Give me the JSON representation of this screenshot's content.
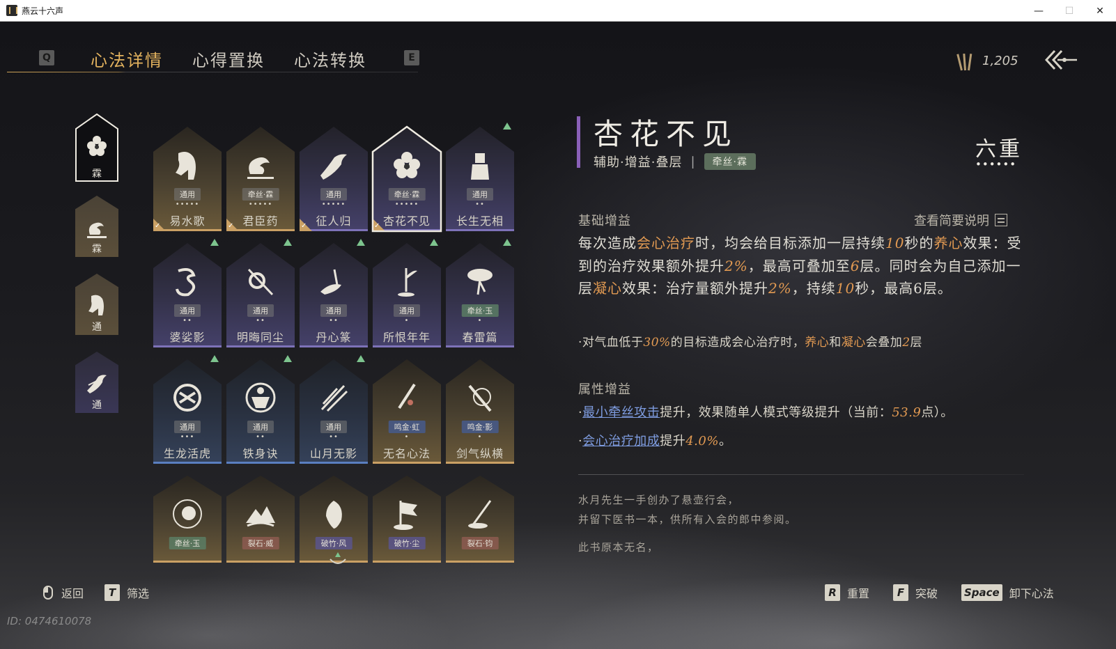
{
  "window": {
    "title": "燕云十六声",
    "min": "—",
    "max": "☐",
    "close": "✕"
  },
  "tabs": {
    "key_left": "Q",
    "key_right": "E",
    "items": [
      "心法详情",
      "心得置换",
      "心法转换"
    ],
    "active": 0
  },
  "currency": {
    "value": "1,205"
  },
  "categories": [
    {
      "label": "霖",
      "icon": "flower-icon",
      "selected": true
    },
    {
      "label": "霖",
      "icon": "cauldron-icon",
      "selected": false
    },
    {
      "label": "通",
      "icon": "horse-icon",
      "selected": false
    },
    {
      "label": "通",
      "icon": "bird-icon",
      "selected": false
    }
  ],
  "cards": [
    {
      "name": "易水歌",
      "tag": "通用",
      "tag_color": "gray",
      "dots": "•••••",
      "bg": "gold",
      "checked": true,
      "up": false,
      "icon": "horse-icon"
    },
    {
      "name": "君臣药",
      "tag": "牵丝·霖",
      "tag_color": "gray",
      "dots": "•••••",
      "bg": "gold",
      "checked": true,
      "up": false,
      "icon": "cauldron-icon"
    },
    {
      "name": "征人归",
      "tag": "通用",
      "tag_color": "gray",
      "dots": "•••••",
      "bg": "purple",
      "checked": true,
      "up": false,
      "icon": "bird-icon"
    },
    {
      "name": "杏花不见",
      "tag": "牵丝·霖",
      "tag_color": "gray",
      "dots": "•••••",
      "bg": "purple",
      "checked": true,
      "up": false,
      "selected": true,
      "icon": "flower-icon"
    },
    {
      "name": "长生无相",
      "tag": "通用",
      "tag_color": "gray",
      "dots": "••",
      "bg": "purple",
      "checked": false,
      "up": true,
      "icon": "statue-icon"
    },
    {
      "name": "婆娑影",
      "tag": "通用",
      "tag_color": "gray",
      "dots": "••",
      "bg": "purple",
      "checked": false,
      "up": true,
      "icon": "dragon-icon"
    },
    {
      "name": "明晦同尘",
      "tag": "通用",
      "tag_color": "gray",
      "dots": "••",
      "bg": "purple",
      "checked": false,
      "up": true,
      "icon": "snake-icon"
    },
    {
      "name": "丹心篆",
      "tag": "通用",
      "tag_color": "gray",
      "dots": "••",
      "bg": "purple",
      "checked": false,
      "up": true,
      "icon": "brush-icon"
    },
    {
      "name": "所恨年年",
      "tag": "通用",
      "tag_color": "gray",
      "dots": "•",
      "bg": "purple",
      "checked": false,
      "up": true,
      "icon": "bamboo-icon"
    },
    {
      "name": "春雷篇",
      "tag": "牵丝·玉",
      "tag_color": "green",
      "dots": "•",
      "bg": "purple",
      "checked": false,
      "up": true,
      "icon": "tree-icon"
    },
    {
      "name": "生龙活虎",
      "tag": "通用",
      "tag_color": "gray",
      "dots": "•••",
      "bg": "blue",
      "checked": false,
      "up": true,
      "icon": "swirl-icon"
    },
    {
      "name": "铁身诀",
      "tag": "通用",
      "tag_color": "gray",
      "dots": "••",
      "bg": "blue",
      "checked": false,
      "up": true,
      "icon": "body-icon"
    },
    {
      "name": "山月无影",
      "tag": "通用",
      "tag_color": "gray",
      "dots": "••",
      "bg": "blue",
      "checked": false,
      "up": true,
      "icon": "slash-icon"
    },
    {
      "name": "无名心法",
      "tag": "鸣金·虹",
      "tag_color": "blue",
      "dots": "•",
      "bg": "gold",
      "checked": false,
      "up": false,
      "icon": "sword-icon"
    },
    {
      "name": "剑气纵横",
      "tag": "鸣金·影",
      "tag_color": "blue",
      "dots": "•",
      "bg": "gold",
      "checked": false,
      "up": false,
      "icon": "sword-swirl-icon"
    },
    {
      "name": "",
      "tag": "牵丝·玉",
      "tag_color": "green",
      "dots": "",
      "bg": "gold",
      "checked": false,
      "up": false,
      "icon": "rose-icon"
    },
    {
      "name": "",
      "tag": "裂石·威",
      "tag_color": "red",
      "dots": "",
      "bg": "gold",
      "checked": false,
      "up": false,
      "icon": "mountain-icon"
    },
    {
      "name": "",
      "tag": "破竹·风",
      "tag_color": "pur",
      "dots": "",
      "bg": "gold",
      "checked": false,
      "up": false,
      "icon": "mask-icon"
    },
    {
      "name": "",
      "tag": "破竹·尘",
      "tag_color": "pur",
      "dots": "",
      "bg": "gold",
      "checked": false,
      "up": false,
      "icon": "flag-icon"
    },
    {
      "name": "",
      "tag": "裂石·钧",
      "tag_color": "red",
      "dots": "",
      "bg": "gold",
      "checked": false,
      "up": false,
      "icon": "spear-icon"
    }
  ],
  "detail": {
    "title": "杏花不见",
    "subtitle": "辅助·增益·叠层",
    "separator": "|",
    "badge": "牵丝·霖",
    "rank": "六重",
    "rank_dots": "••••••",
    "base_section": "基础增益",
    "view_desc": "查看简要说明",
    "p1": {
      "a": "每次造成",
      "b": "会心治疗",
      "c": "时，均会给目标添加一层持续",
      "d": "10",
      "e": "秒的",
      "f": "养心",
      "g": "效果：受到的治疗效果额外提升",
      "h": "2%",
      "i": "，最高可叠加至",
      "j": "6",
      "k": "层。同时会为自己添加一层",
      "l": "凝心",
      "m": "效果：治疗量额外提升",
      "n": "2%",
      "o": "，持续",
      "p": "10",
      "q": "秒，最高6层。"
    },
    "p2": {
      "a": "·对气血低于",
      "b": "30%",
      "c": "的目标造成会心治疗时，",
      "d": "养心",
      "e": "和",
      "f": "凝心",
      "g": "会叠加",
      "h": "2",
      "i": "层"
    },
    "attr_section": "属性增益",
    "attr1": {
      "dot": "·",
      "link": "最小牵丝攻击",
      "text": "提升，效果随单人模式等级提升（当前：",
      "value": "53.9",
      "tail": "点）。"
    },
    "attr2": {
      "dot": "·",
      "link": "会心治疗加成",
      "text": "提升",
      "value": "4.0%",
      "tail": "。"
    },
    "lore1": "水月先生一手创办了悬壶行会，",
    "lore2": "并留下医书一本，供所有入会的郎中参阅。",
    "lore3": "此书原本无名，"
  },
  "bottom": {
    "back_label": "返回",
    "filter_key": "T",
    "filter_label": "筛选",
    "reset_key": "R",
    "reset_label": "重置",
    "break_key": "F",
    "break_label": "突破",
    "remove_key": "Space",
    "remove_label": "卸下心法"
  },
  "uid": "ID: 0474610078",
  "colors": {
    "accent": "#e2b25e",
    "highlight": "#e29a52",
    "link": "#7e9ce0",
    "badge": "#5c6e5c",
    "title_accent": "#8a60b8"
  }
}
